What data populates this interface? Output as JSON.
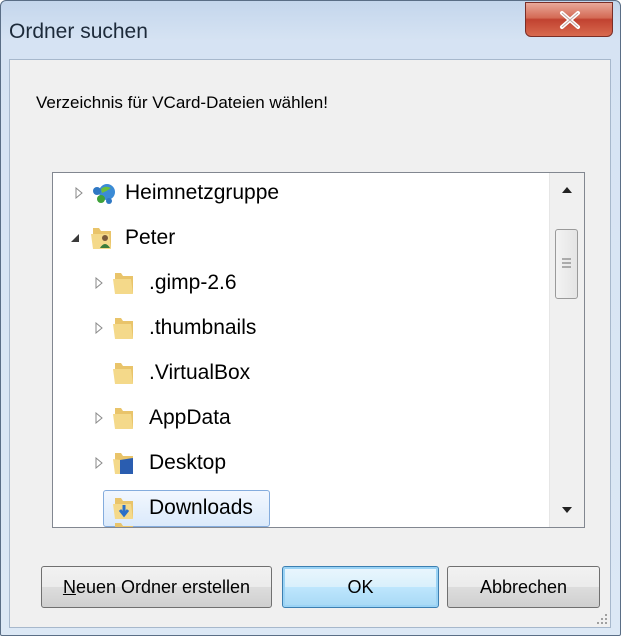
{
  "window": {
    "title": "Ordner suchen"
  },
  "dialog": {
    "prompt": "Verzeichnis für VCard-Dateien wählen!"
  },
  "tree": {
    "items": [
      {
        "label": "Heimnetzgruppe",
        "icon": "homegroup-icon",
        "expander": "collapsed"
      },
      {
        "label": "Peter",
        "icon": "user-folder-icon",
        "expander": "expanded"
      },
      {
        "label": ".gimp-2.6",
        "icon": "folder-icon",
        "expander": "collapsed"
      },
      {
        "label": ".thumbnails",
        "icon": "folder-icon",
        "expander": "collapsed"
      },
      {
        "label": ".VirtualBox",
        "icon": "folder-icon",
        "expander": "none"
      },
      {
        "label": "AppData",
        "icon": "folder-icon",
        "expander": "collapsed"
      },
      {
        "label": "Desktop",
        "icon": "desktop-folder-icon",
        "expander": "collapsed"
      },
      {
        "label": "Downloads",
        "icon": "downloads-folder-icon",
        "expander": "none",
        "selected": true
      }
    ],
    "scroll_position": 0.15
  },
  "buttons": {
    "new_folder_access_key": "N",
    "new_folder_rest": "euen Ordner erstellen",
    "ok": "OK",
    "cancel": "Abbrechen"
  },
  "colors": {
    "selection_border": "#84acdd",
    "close_button": "#c14230",
    "default_button_border": "#3c7fb1"
  }
}
